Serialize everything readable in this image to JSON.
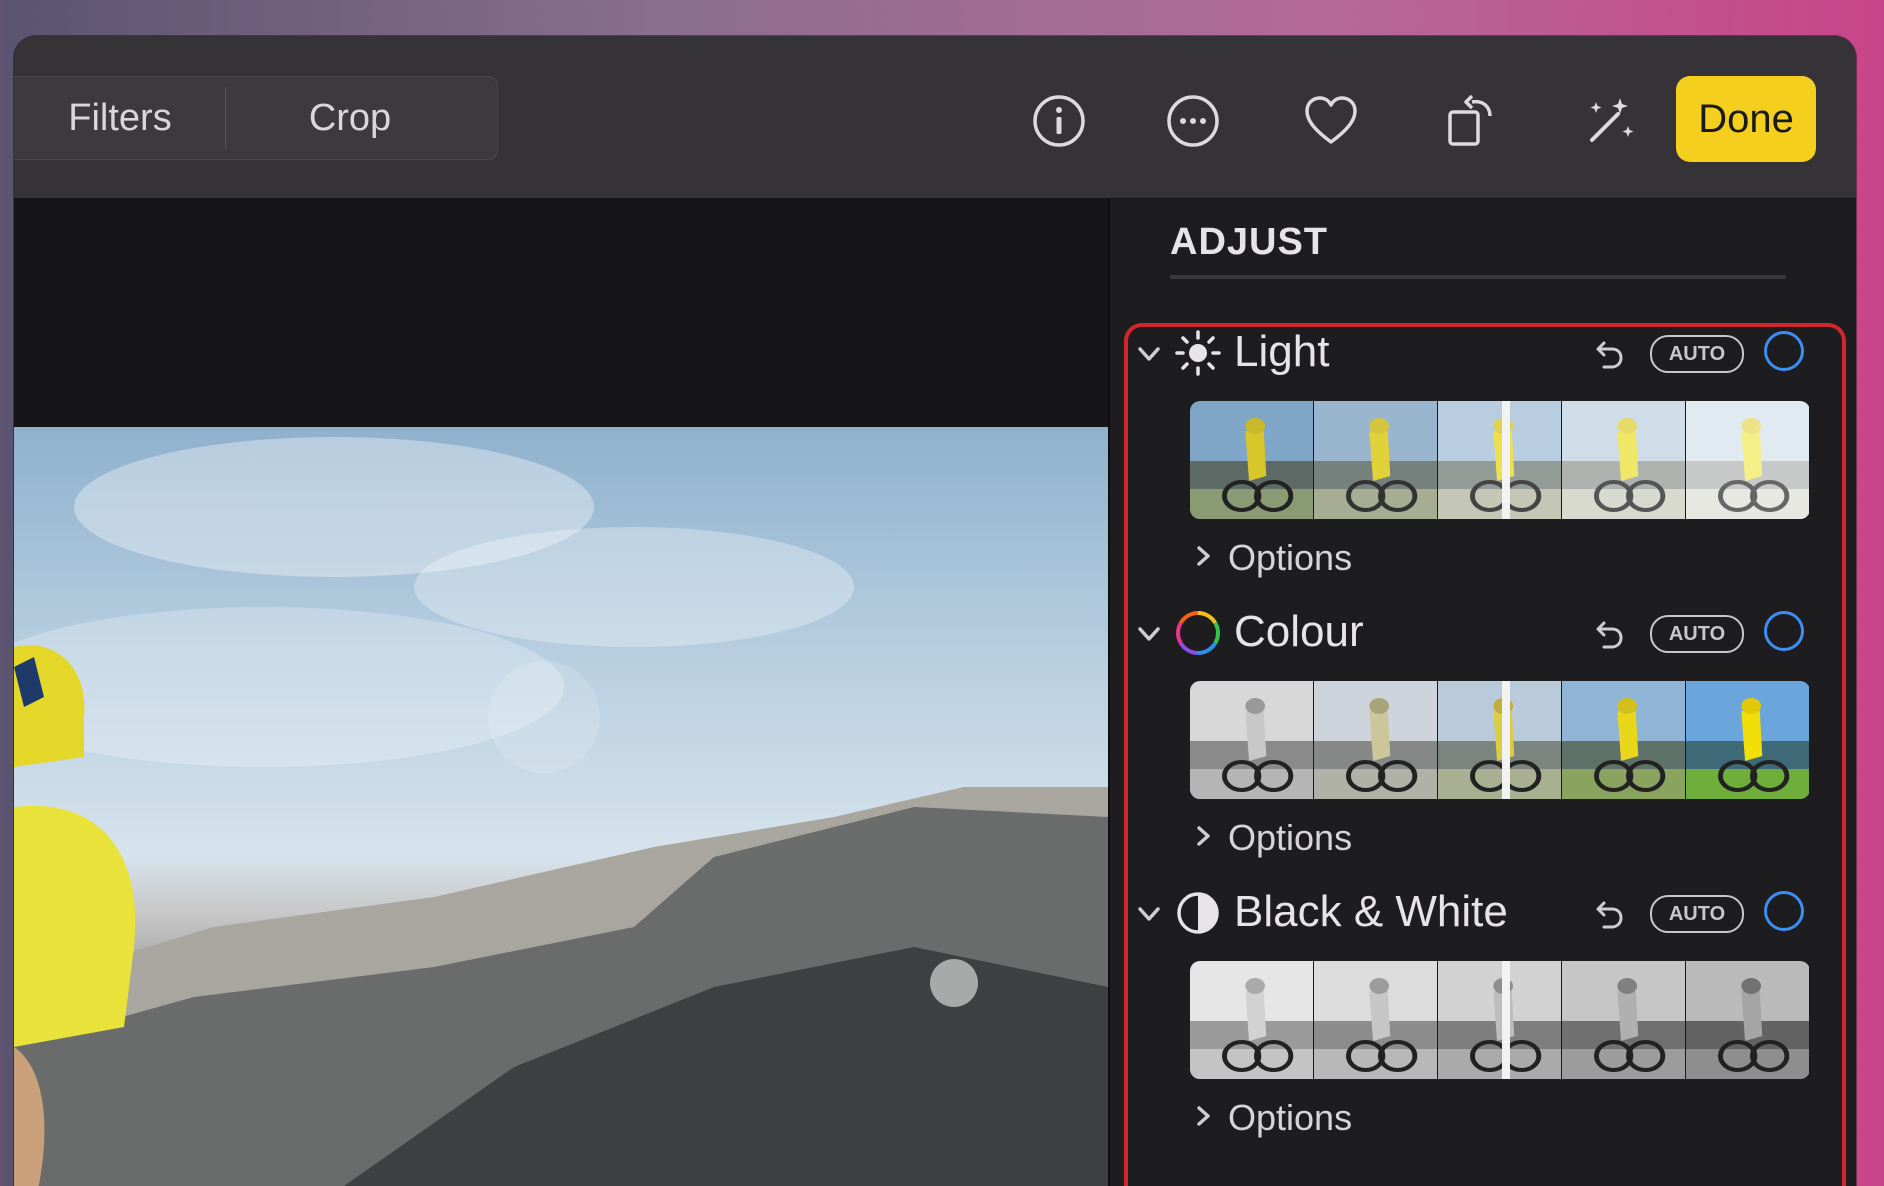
{
  "toolbar": {
    "segments": [
      {
        "label": "Filters"
      },
      {
        "label": "Crop"
      }
    ],
    "icons": [
      "info-circle-icon",
      "more-ellipsis-icon",
      "heart-icon",
      "rotate-icon",
      "magic-wand-enhance-icon"
    ],
    "done_label": "Done",
    "accent": "#f5cf1d"
  },
  "sidebar": {
    "title": "ADJUST",
    "highlight_color": "#d2262e",
    "sections": [
      {
        "title": "Light",
        "icon": "sun-icon",
        "auto_label": "AUTO",
        "options_label": "Options",
        "strip_style": "colour"
      },
      {
        "title": "Colour",
        "icon": "colour-wheel-icon",
        "auto_label": "AUTO",
        "options_label": "Options",
        "strip_style": "mixed"
      },
      {
        "title": "Black & White",
        "icon": "half-circle-icon",
        "auto_label": "AUTO",
        "options_label": "Options",
        "strip_style": "mono"
      }
    ]
  }
}
